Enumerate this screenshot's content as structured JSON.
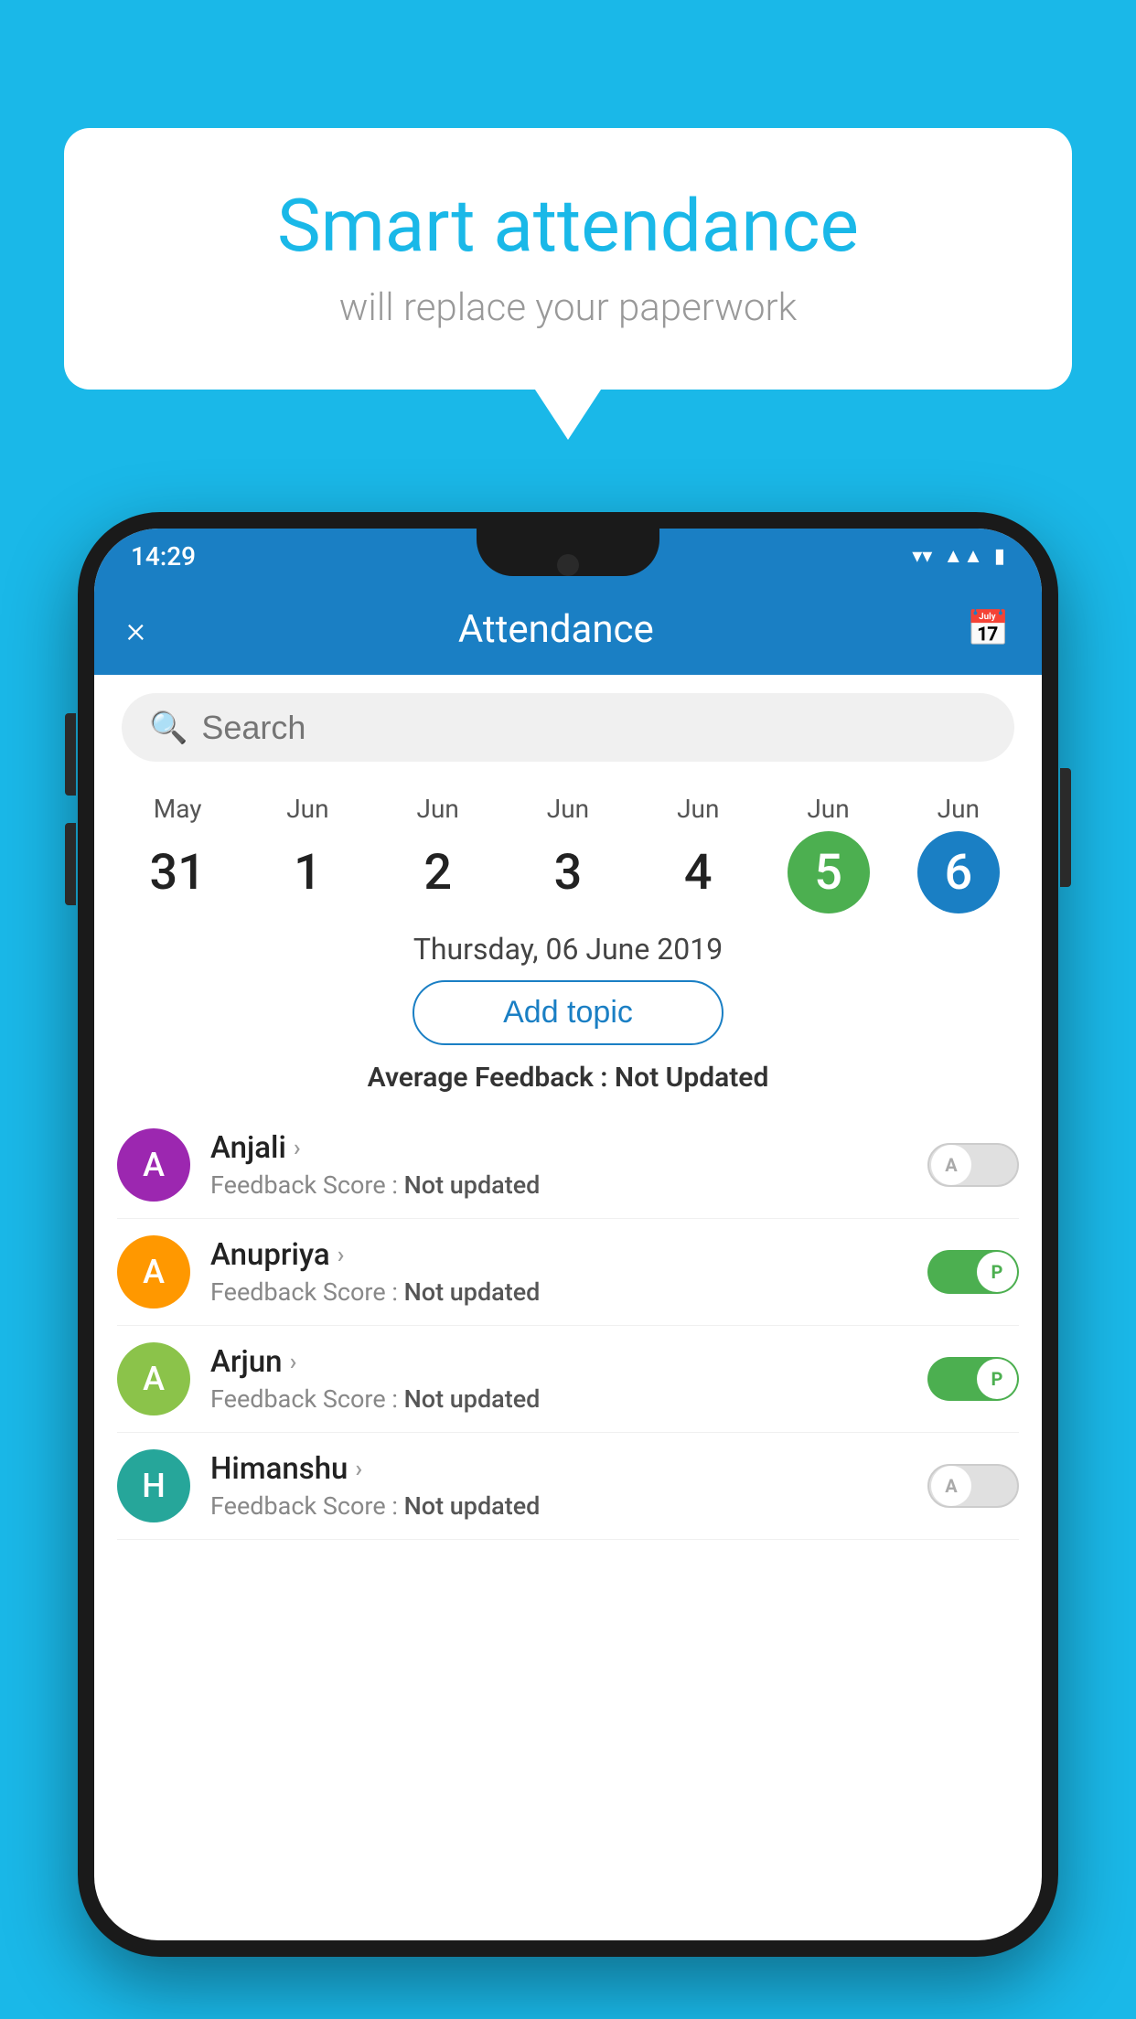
{
  "background_color": "#1ab8e8",
  "speech_bubble": {
    "title": "Smart attendance",
    "subtitle": "will replace your paperwork"
  },
  "status_bar": {
    "time": "14:29",
    "wifi": "▼",
    "signal": "▲",
    "battery": "▮"
  },
  "app_bar": {
    "title": "Attendance",
    "close_label": "×",
    "calendar_icon": "📅"
  },
  "search": {
    "placeholder": "Search"
  },
  "calendar": {
    "days": [
      {
        "month": "May",
        "date": "31",
        "style": "normal"
      },
      {
        "month": "Jun",
        "date": "1",
        "style": "normal"
      },
      {
        "month": "Jun",
        "date": "2",
        "style": "normal"
      },
      {
        "month": "Jun",
        "date": "3",
        "style": "normal"
      },
      {
        "month": "Jun",
        "date": "4",
        "style": "normal"
      },
      {
        "month": "Jun",
        "date": "5",
        "style": "green"
      },
      {
        "month": "Jun",
        "date": "6",
        "style": "blue"
      }
    ]
  },
  "selected_date": "Thursday, 06 June 2019",
  "add_topic_label": "Add topic",
  "avg_feedback_label": "Average Feedback :",
  "avg_feedback_value": "Not Updated",
  "students": [
    {
      "name": "Anjali",
      "avatar_letter": "A",
      "avatar_color": "purple",
      "feedback_label": "Feedback Score :",
      "feedback_value": "Not updated",
      "toggle_state": "off",
      "toggle_letter": "A"
    },
    {
      "name": "Anupriya",
      "avatar_letter": "A",
      "avatar_color": "orange",
      "feedback_label": "Feedback Score :",
      "feedback_value": "Not updated",
      "toggle_state": "on",
      "toggle_letter": "P"
    },
    {
      "name": "Arjun",
      "avatar_letter": "A",
      "avatar_color": "light-green",
      "feedback_label": "Feedback Score :",
      "feedback_value": "Not updated",
      "toggle_state": "on",
      "toggle_letter": "P"
    },
    {
      "name": "Himanshu",
      "avatar_letter": "H",
      "avatar_color": "teal",
      "feedback_label": "Feedback Score :",
      "feedback_value": "Not updated",
      "toggle_state": "off",
      "toggle_letter": "A"
    }
  ]
}
